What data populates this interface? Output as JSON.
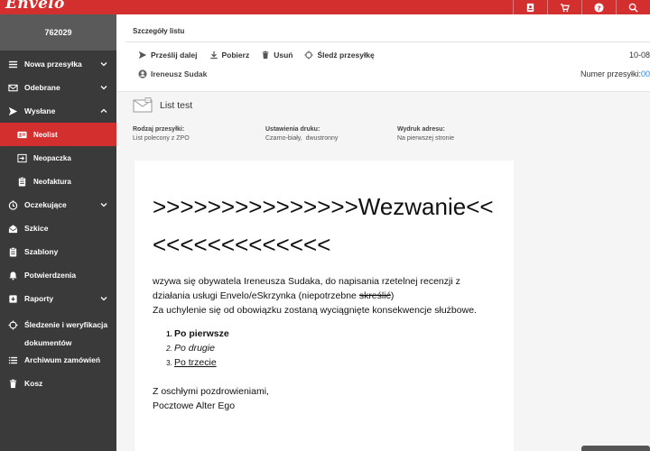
{
  "app": {
    "logo": "Envelo"
  },
  "topbar": {
    "icons": [
      "id-badge-icon",
      "cart-icon",
      "help-icon",
      "search-icon"
    ]
  },
  "sidebar": {
    "user_id": "762029",
    "items": {
      "nowa": "Nowa przesyłka",
      "odebrane": "Odebrane",
      "wyslane": "Wysłane",
      "neolist": "Neolist",
      "neopaczka": "Neopaczka",
      "neofaktura": "Neofaktura",
      "oczekujace": "Oczekujące",
      "szkice": "Szkice",
      "szablony": "Szablony",
      "potwierdzenia": "Potwierdzenia",
      "raporty": "Raporty",
      "sledzenie": "Śledzenie i weryfikacja dokumentów",
      "archiwum": "Archiwum zamówień",
      "kosz": "Kosz"
    }
  },
  "main": {
    "title": "Szczegóły listu",
    "toolbar": {
      "forward": "Prześlij dalej",
      "download": "Pobierz",
      "delete": "Usuń",
      "track": "Śledź przesyłkę"
    },
    "date": "10-08",
    "sender": "Ireneusz Sudak",
    "tracking_label": "Numer przesyłki:",
    "tracking_num": "00",
    "letter_title": "List test",
    "meta": {
      "type_label": "Rodzaj przesyłki:",
      "type_value": "List polecony z ZPO",
      "print_label": "Ustawienia druku:",
      "print_value": "Czarno-biały,  dwustronny",
      "address_label": "Wydruk adresu:",
      "address_value": "Na pierwszej stronie"
    }
  },
  "document": {
    "heading": ">>>>>>>>>>>>>>>Wezwanie<<<<<<<<<<<<<<<",
    "p1_a": "wzywa się obywatela Ireneusza Sudaka, do napisania rzetelnej recenzji z działania usługi Envelo/eSkrzynka (niepotrzebne ",
    "p1_strike": "skreślić",
    "p1_b": ")",
    "p2": "Za uchylenie się od obowiązku zostaną wyciągnięte konsekwencje służbowe.",
    "list": [
      "Po pierwsze",
      "Po drugie",
      "Po trzecie"
    ],
    "closing1": "Z oschłymi pozdrowieniami,",
    "closing2": "Pocztowe Alter Ego"
  }
}
